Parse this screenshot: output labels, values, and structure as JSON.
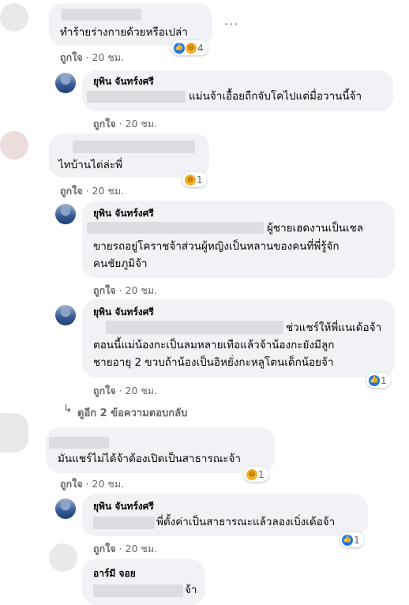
{
  "comments": [
    {
      "text": "ทำร้ายร่างกายด้วยหรือเปล่า",
      "meta": {
        "like": "ถูกใจ",
        "time": "20 ชม."
      },
      "reaction_count": "4"
    },
    {
      "author": "ยุพิน จันทร์งศรี",
      "text": "แม่นจ้าเอื้อยถืกจับโคไปแต่มื่อวานนี้จ้า",
      "meta": {
        "like": "ถูกใจ",
        "time": "20 ชม."
      }
    },
    {
      "text": "ไทบ้านไต่ล่ะพี่",
      "meta": {
        "like": "ถูกใจ",
        "time": "20 ชม."
      },
      "reaction_count": "1"
    },
    {
      "author": "ยุพิน จันทร์งศรี",
      "lines": [
        "ผู้ชายเฮดงานเป็นเชล",
        "ขายรถอยู่โคราชจ้าส่วนผู้หญิงเป็นหลานของคนที่พี่รู้จัก",
        "คนชัยภูมิจ้า"
      ],
      "meta": {
        "like": "ถูกใจ",
        "time": "20 ชม."
      }
    },
    {
      "author": "ยุพิน จันทร์งศรี",
      "lines": [
        "ช่วแชร์ให้พี่แนเด้อจ้า",
        "ตอนนี้แม่น้องกะเป็นลมหลายเทือแล้วจ้าน้องกะยังมีลูก",
        "ชายอายุ 2 ขวบถ้าน้องเป็นอิหยั่งกะหลูโตนเด็กน้อยจ้า"
      ],
      "meta": {
        "like": "ถูกใจ",
        "time": "20 ชม."
      },
      "reaction_count": "1"
    },
    {
      "text": "มันแชร์ไม่ได้จ้าต้องเปิดเป็นสาธารณะจ้า",
      "meta": {
        "like": "ถูกใจ",
        "time": "20 ชม."
      },
      "reaction_count": "1"
    },
    {
      "author": "ยุพิน จันทร์งศรี",
      "text": "พี่ตั้งค่าเป็นสาธารณะแล้วลองเบิ่งเด้อจ้า",
      "reaction_count": "1"
    },
    {
      "author": "อาร์มี จอย",
      "text": "จ้า"
    }
  ],
  "meta_row8": {
    "like": "ถูกใจ",
    "time": "20 ชม."
  },
  "view_more": "ดูอีก 2 ข้อความตอบกลับ",
  "more_icon": "more-horizontal-icon",
  "colors": {
    "like": "#1877f2",
    "haha": "#f7b125",
    "bubble": "#f0f2f5",
    "meta": "#65676b"
  }
}
